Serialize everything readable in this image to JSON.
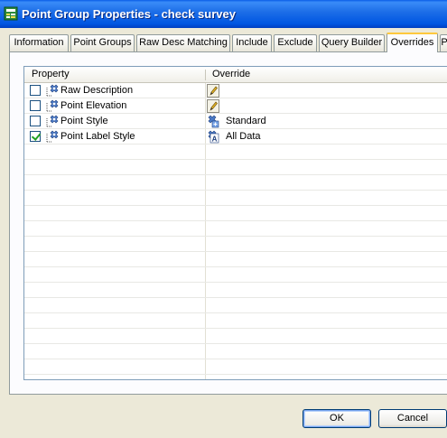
{
  "window": {
    "title": "Point Group Properties - check survey"
  },
  "tabs": [
    {
      "label": "Information"
    },
    {
      "label": "Point Groups"
    },
    {
      "label": "Raw Desc Matching"
    },
    {
      "label": "Include"
    },
    {
      "label": "Exclude"
    },
    {
      "label": "Query Builder"
    },
    {
      "label": "Overrides"
    },
    {
      "label": "P"
    }
  ],
  "active_tab": "Overrides",
  "grid": {
    "columns": {
      "property": "Property",
      "override": "Override"
    },
    "rows": [
      {
        "property": "Raw Description",
        "checked": false,
        "override_icon": "pencil-icon",
        "override_value": ""
      },
      {
        "property": "Point Elevation",
        "checked": false,
        "override_icon": "pencil-icon",
        "override_value": ""
      },
      {
        "property": "Point Style",
        "checked": false,
        "override_icon": "point-style-icon",
        "override_value": "Standard"
      },
      {
        "property": "Point Label Style",
        "checked": true,
        "override_icon": "label-style-icon",
        "override_value": "All Data"
      }
    ]
  },
  "buttons": {
    "ok": "OK",
    "cancel": "Cancel"
  },
  "colors": {
    "titlebar": "#0056e2",
    "dialog_bg": "#ece9d8",
    "active_tab_accent": "#ffc83c",
    "checkmark": "#21a121"
  }
}
